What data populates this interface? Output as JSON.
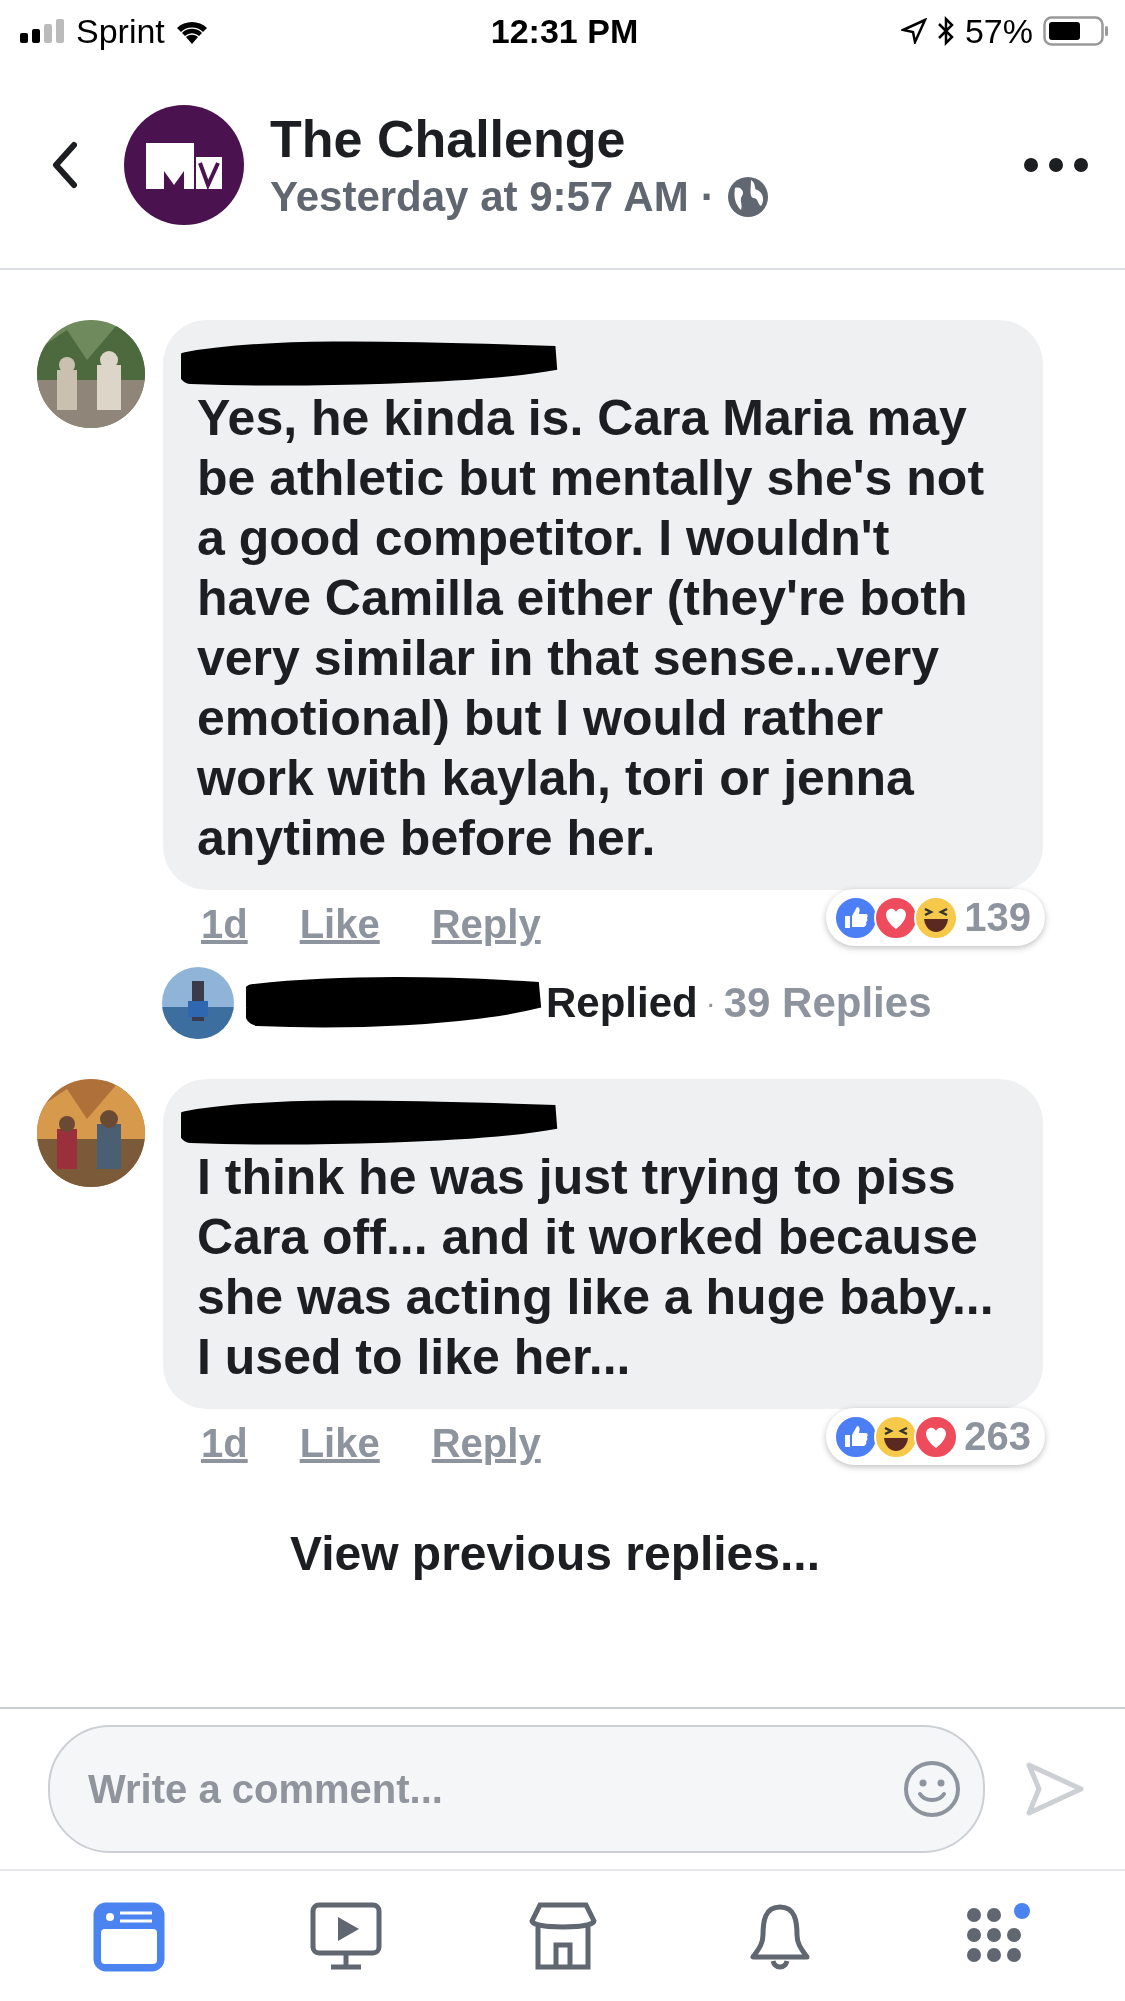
{
  "status_bar": {
    "carrier": "Sprint",
    "time": "12:31 PM",
    "battery": "57%"
  },
  "header": {
    "title": "The Challenge",
    "timestamp": "Yesterday at 9:57 AM",
    "separator": "·"
  },
  "comments": [
    {
      "text": "Yes, he kinda is. Cara Maria may be athletic but mentally she's not a good competitor. I wouldn't have Camilla either (they're both very similar in that sense...very emotional) but I would rather work with kaylah, tori or jenna anytime before her.",
      "age": "1d",
      "like": "Like",
      "reply": "Reply",
      "reactions": [
        {
          "kind": "like"
        },
        {
          "kind": "love"
        },
        {
          "kind": "haha"
        }
      ],
      "reaction_count": "139",
      "replies": {
        "label": "Replied",
        "separator": "·",
        "count": "39 Replies"
      }
    },
    {
      "text": "I think he was just trying to piss Cara off... and it worked because she was acting like a huge baby... I used to like her...",
      "age": "1d",
      "like": "Like",
      "reply": "Reply",
      "reactions": [
        {
          "kind": "like"
        },
        {
          "kind": "haha"
        },
        {
          "kind": "love"
        }
      ],
      "reaction_count": "263"
    }
  ],
  "view_previous": "View previous replies...",
  "composer": {
    "placeholder": "Write a comment..."
  },
  "tab_bar": [
    {
      "kind": "news",
      "selected": true,
      "badge": false
    },
    {
      "kind": "video",
      "selected": false,
      "badge": false
    },
    {
      "kind": "market",
      "selected": false,
      "badge": false
    },
    {
      "kind": "bell",
      "selected": false,
      "badge": false
    },
    {
      "kind": "menu",
      "selected": false,
      "badge": true
    }
  ]
}
